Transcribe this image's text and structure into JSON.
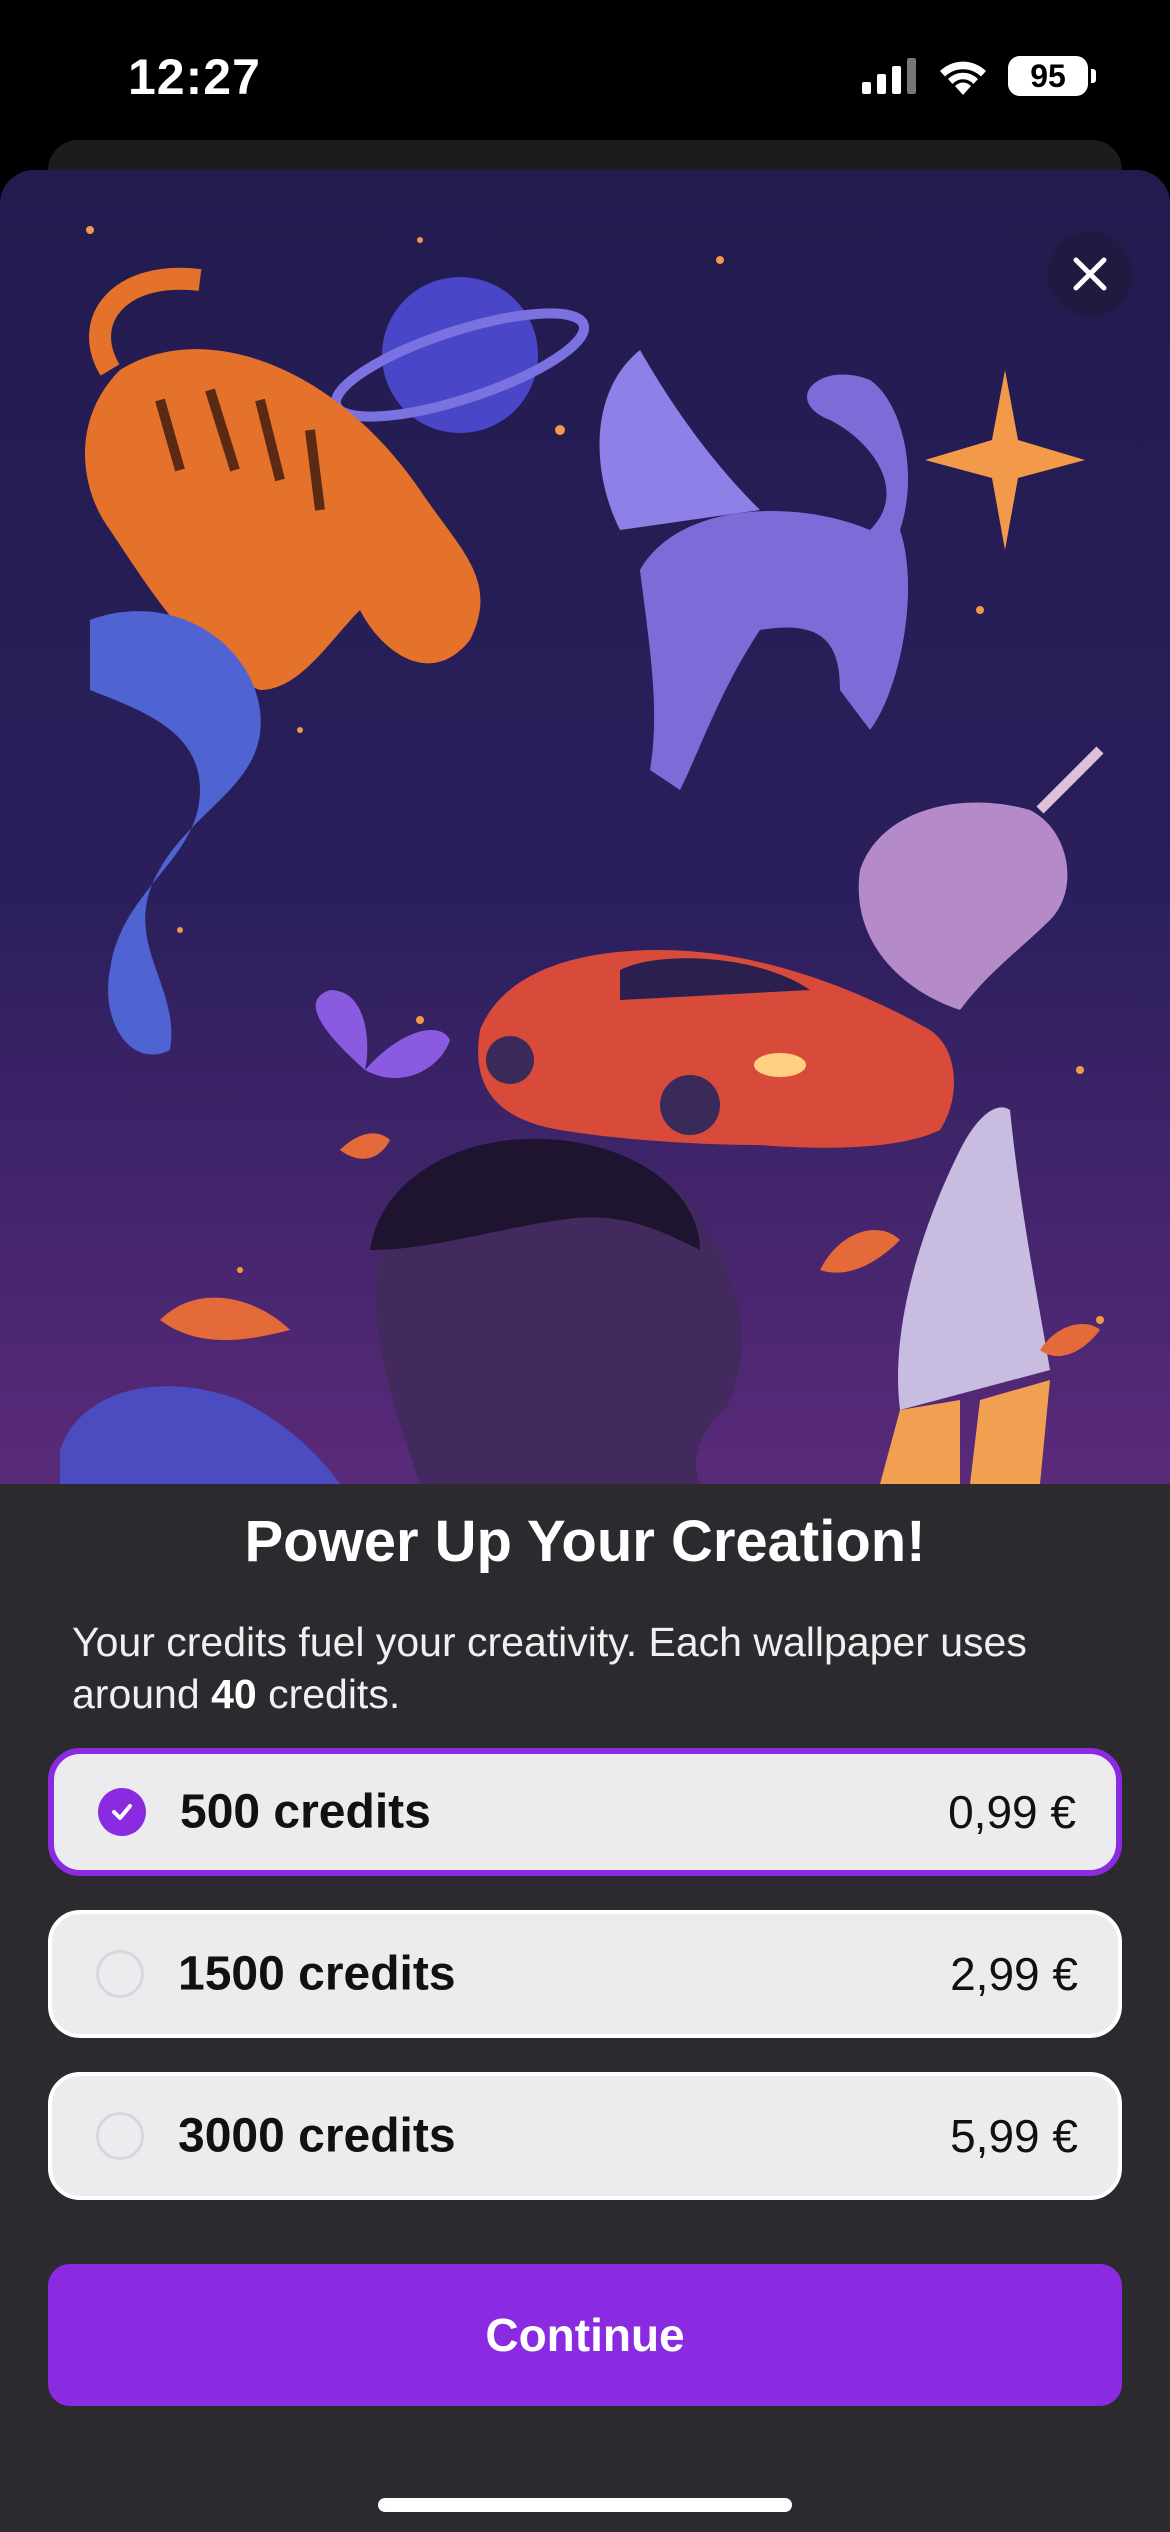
{
  "status_bar": {
    "time": "12:27",
    "battery": "95"
  },
  "sheet": {
    "title": "Power Up Your Creation!",
    "subtitle_before": "Your credits fuel your creativity. Each wallpaper uses around ",
    "subtitle_bold": "40",
    "subtitle_after": " credits.",
    "options": [
      {
        "label": "500 credits",
        "price": "0,99 €",
        "selected": true
      },
      {
        "label": "1500 credits",
        "price": "2,99 €",
        "selected": false
      },
      {
        "label": "3000 credits",
        "price": "5,99 €",
        "selected": false
      }
    ],
    "continue_label": "Continue"
  },
  "colors": {
    "accent": "#8a2be2",
    "sheet_bg": "#2c2a2e",
    "option_bg": "#ececef"
  },
  "icons": [
    "signal-icon",
    "wifi-icon",
    "battery-icon",
    "close-icon",
    "check-icon"
  ]
}
